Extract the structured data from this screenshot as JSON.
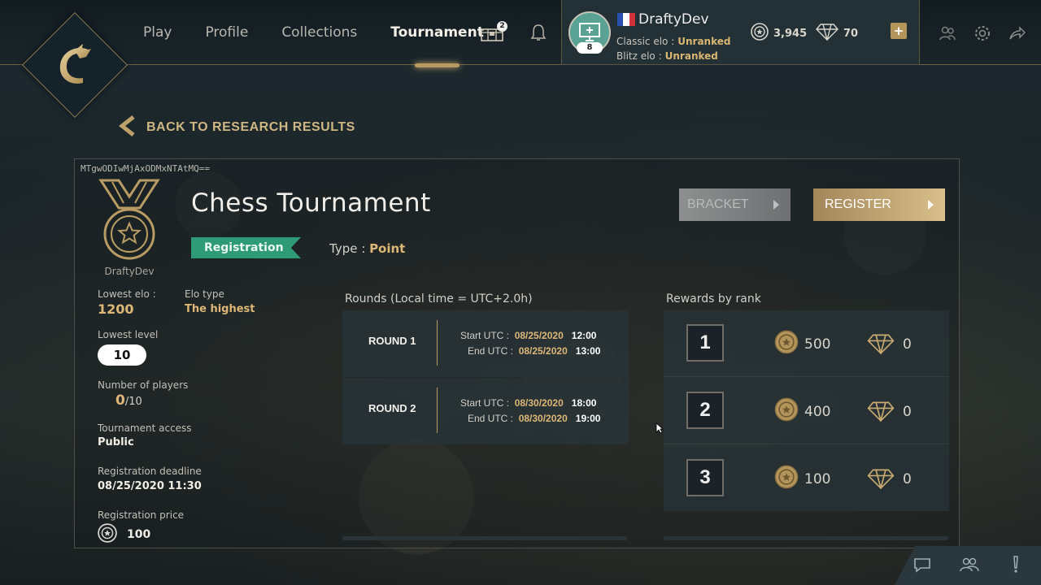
{
  "nav": {
    "items": [
      {
        "label": "Play",
        "active": false
      },
      {
        "label": "Profile",
        "active": false
      },
      {
        "label": "Collections",
        "active": false
      },
      {
        "label": "Tournament",
        "active": true
      }
    ],
    "chest_badge": "2",
    "icons": [
      "treasure-chest-icon",
      "bell-icon"
    ]
  },
  "profile": {
    "username": "DraftyDev",
    "level": "8",
    "flag": "france",
    "classic_elo_label": "Classic elo :",
    "classic_elo_value": "Unranked",
    "blitz_elo_label": "Blitz elo :",
    "blitz_elo_value": "Unranked",
    "coins": "3,945",
    "gems": "70",
    "add_label": "+"
  },
  "back_link": "BACK TO RESEARCH RESULTS",
  "tournament": {
    "id": "MTgwODIwMjAxODMxNTAtMQ==",
    "owner": "DraftyDev",
    "title": "Chess Tournament",
    "status": "Registration",
    "type_label": "Type :",
    "type_value": "Point",
    "bracket_label": "BRACKET",
    "register_label": "REGISTER",
    "lowest_elo_label": "Lowest elo :",
    "lowest_elo_value": "1200",
    "elo_type_label": "Elo type",
    "elo_type_value": "The highest",
    "lowest_level_label": "Lowest level",
    "lowest_level_value": "10",
    "players_label": "Number of players",
    "players_current": "0",
    "players_max": "/10",
    "access_label": "Tournament access",
    "access_value": "Public",
    "deadline_label": "Registration deadline",
    "deadline_value": "08/25/2020 11:30",
    "price_label": "Registration price",
    "price_value": "100"
  },
  "rounds": {
    "heading": "Rounds (Local time = UTC+2.0h)",
    "start_label": "Start UTC :",
    "end_label": "End UTC :",
    "items": [
      {
        "name": "ROUND 1",
        "start_date": "08/25/2020",
        "start_time": "12:00",
        "end_date": "08/25/2020",
        "end_time": "13:00"
      },
      {
        "name": "ROUND 2",
        "start_date": "08/30/2020",
        "start_time": "18:00",
        "end_date": "08/30/2020",
        "end_time": "19:00"
      }
    ]
  },
  "rewards": {
    "heading": "Rewards by rank",
    "items": [
      {
        "rank": "1",
        "coins": "500",
        "gems": "0"
      },
      {
        "rank": "2",
        "coins": "400",
        "gems": "0"
      },
      {
        "rank": "3",
        "coins": "100",
        "gems": "0"
      }
    ]
  },
  "colors": {
    "accent_gold": "#dcb777",
    "status_green": "#2f9a76",
    "background": "#1d2a30"
  }
}
